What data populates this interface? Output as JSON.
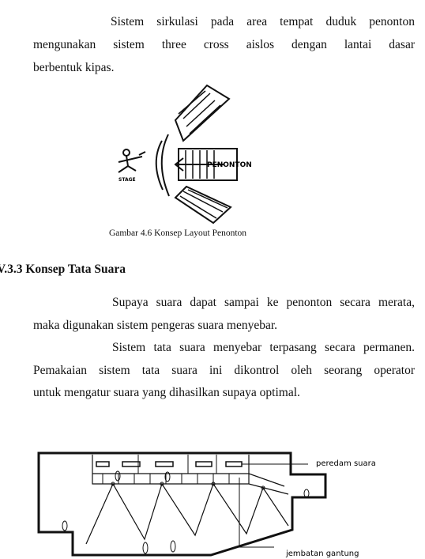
{
  "paragraph1": {
    "lines": [
      "Sistem sirkulasi pada area tempat duduk penonton",
      "mengunakan sistem three cross aislos dengan lantai dasar",
      "berbentuk kipas."
    ]
  },
  "figure1": {
    "label_stage": "STAGE",
    "label_audience": "PENONTON",
    "caption": "Gambar 4.6 Konsep Layout Penonton"
  },
  "section": {
    "heading": "V.3.3 Konsep Tata Suara"
  },
  "paragraph2": {
    "lines": [
      "Supaya suara dapat sampai ke penonton secara merata,",
      "maka digunakan sistem pengeras suara menyebar."
    ]
  },
  "paragraph3": {
    "lines": [
      "Sistem tata suara menyebar terpasang secara permanen.",
      "Pemakaian sistem tata suara ini dikontrol oleh seorang operator",
      "untuk mengatur suara yang dihasilkan supaya optimal."
    ]
  },
  "figure2": {
    "label_damper": "peredam suara",
    "label_bridge": "jembatan gantung"
  }
}
